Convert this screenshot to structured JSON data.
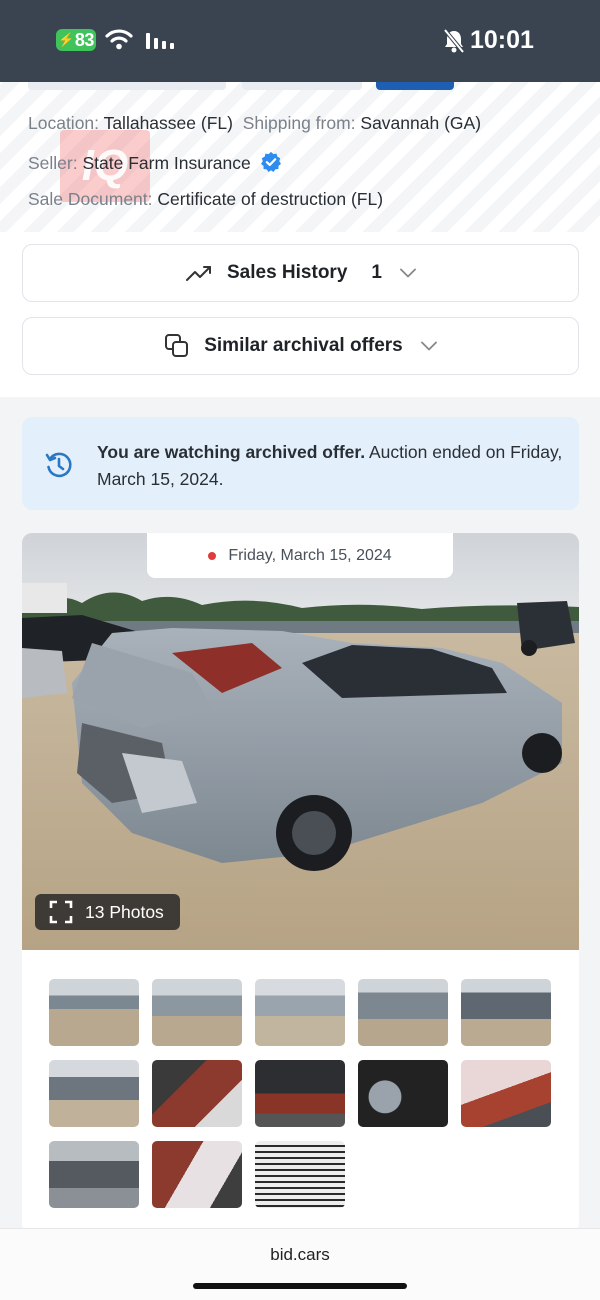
{
  "status_bar": {
    "battery": "83",
    "time": "10:01"
  },
  "info": {
    "location_label": "Location:",
    "location_value": "Tallahassee (FL)",
    "shipping_label": "Shipping from:",
    "shipping_value": "Savannah (GA)",
    "seller_label": "Seller:",
    "seller_value": "State Farm Insurance",
    "sale_doc_label": "Sale Document:",
    "sale_doc_value": "Certificate of destruction (FL)",
    "watermark": "IQ"
  },
  "accordions": {
    "sales_history_label": "Sales History",
    "sales_history_count": "1",
    "similar_label": "Similar archival offers"
  },
  "notice": {
    "bold": "You are watching archived offer.",
    "rest": " Auction ended on Friday, March 15, 2024."
  },
  "gallery": {
    "date": "Friday, March 15, 2024",
    "photos_label": "13 Photos",
    "thumbnail_count": 13
  },
  "browser": {
    "url": "bid.cars"
  },
  "colors": {
    "status_bar_bg": "#3a4350",
    "accent_blue": "#1f5fb3",
    "notice_bg": "#e3f0fb",
    "verified_blue": "#2d8cf0",
    "live_dot": "#e23b3b"
  }
}
